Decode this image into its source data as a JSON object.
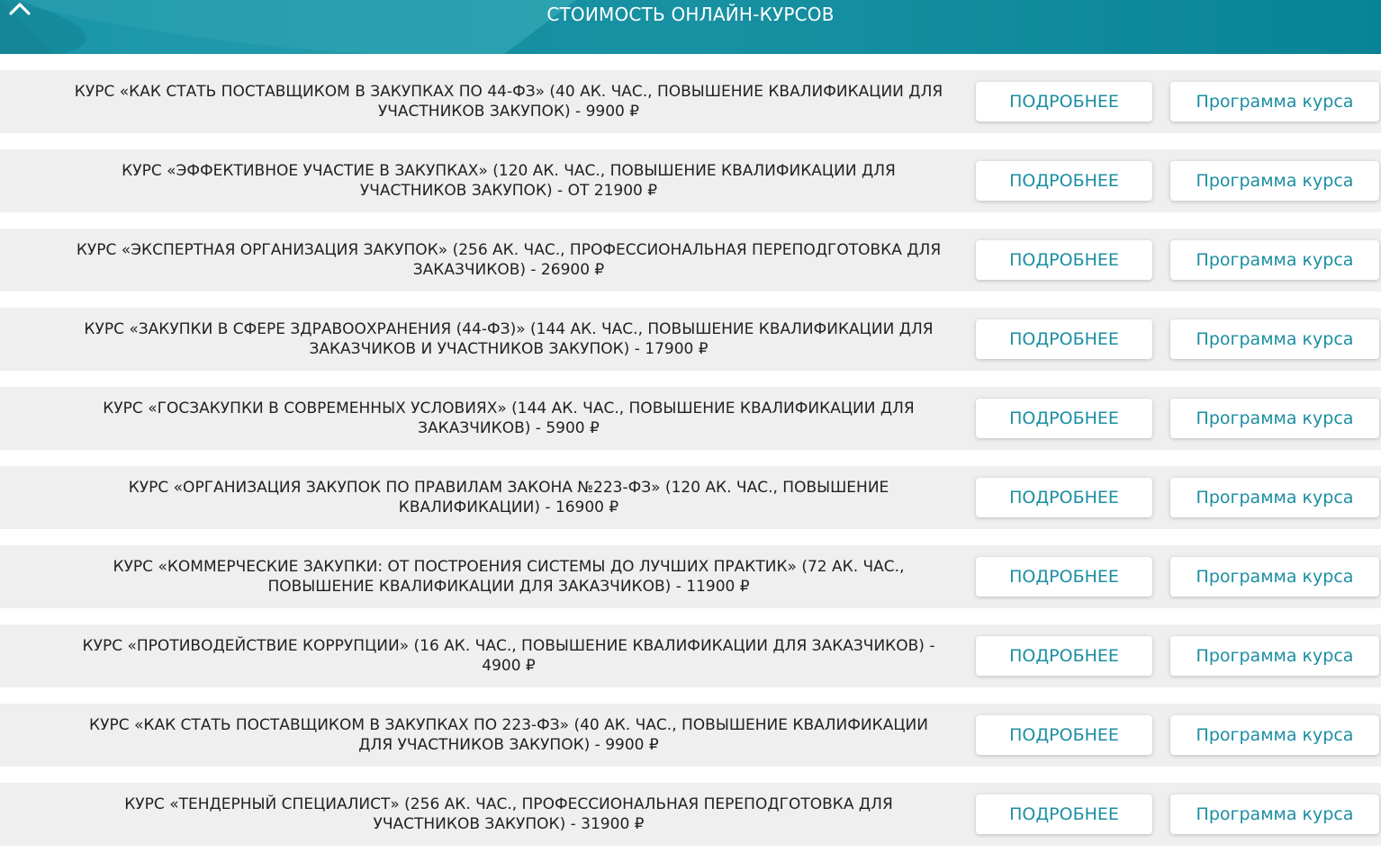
{
  "header": {
    "title": "СТОИМОСТЬ ОНЛАЙН-КУРСОВ",
    "toggle_icon": "chevron-up-icon",
    "bg_color": "#0d8a9e",
    "accent_color": "#1b8ea2"
  },
  "courses": [
    {
      "line1": "КУРС «КАК СТАТЬ ПОСТАВЩИКОМ В ЗАКУПКАХ ПО 44-ФЗ» (40 АК. ЧАС., ПОВЫШЕНИЕ КВАЛИФИКАЦИИ ДЛЯ",
      "line2": "УЧАСТНИКОВ ЗАКУПОК) - 9900 ₽",
      "more_label": "ПОДРОБНЕЕ",
      "program_label": "Программа курса"
    },
    {
      "line1": "КУРС «ЭФФЕКТИВНОЕ УЧАСТИЕ В ЗАКУПКАХ» (120 АК. ЧАС., ПОВЫШЕНИЕ КВАЛИФИКАЦИИ ДЛЯ",
      "line2": "УЧАСТНИКОВ ЗАКУПОК) - ОТ 21900 ₽",
      "more_label": "ПОДРОБНЕЕ",
      "program_label": "Программа курса"
    },
    {
      "line1": "КУРС «ЭКСПЕРТНАЯ ОРГАНИЗАЦИЯ ЗАКУПОК» (256 АК. ЧАС., ПРОФЕССИОНАЛЬНАЯ ПЕРЕПОДГОТОВКА ДЛЯ",
      "line2": "ЗАКАЗЧИКОВ) - 26900 ₽",
      "more_label": "ПОДРОБНЕЕ",
      "program_label": "Программа курса"
    },
    {
      "line1": "КУРС «ЗАКУПКИ В СФЕРЕ ЗДРАВООХРАНЕНИЯ (44-ФЗ)» (144 АК. ЧАС., ПОВЫШЕНИЕ КВАЛИФИКАЦИИ ДЛЯ",
      "line2": "ЗАКАЗЧИКОВ И УЧАСТНИКОВ ЗАКУПОК) - 17900 ₽",
      "more_label": "ПОДРОБНЕЕ",
      "program_label": "Программа курса"
    },
    {
      "line1": "КУРС «ГОСЗАКУПКИ В СОВРЕМЕННЫХ УСЛОВИЯХ» (144 АК. ЧАС., ПОВЫШЕНИЕ КВАЛИФИКАЦИИ ДЛЯ",
      "line2": "ЗАКАЗЧИКОВ) - 5900 ₽",
      "more_label": "ПОДРОБНЕЕ",
      "program_label": "Программа курса"
    },
    {
      "line1": "КУРС «ОРГАНИЗАЦИЯ ЗАКУПОК ПО ПРАВИЛАМ ЗАКОНА №223-ФЗ» (120 АК. ЧАС., ПОВЫШЕНИЕ",
      "line2": "КВАЛИФИКАЦИИ) - 16900 ₽",
      "more_label": "ПОДРОБНЕЕ",
      "program_label": "Программа курса"
    },
    {
      "line1": "КУРС «КОММЕРЧЕСКИЕ ЗАКУПКИ: ОТ ПОСТРОЕНИЯ СИСТЕМЫ ДО ЛУЧШИХ ПРАКТИК» (72 АК. ЧАС.,",
      "line2": "ПОВЫШЕНИЕ КВАЛИФИКАЦИИ ДЛЯ ЗАКАЗЧИКОВ) - 11900 ₽",
      "more_label": "ПОДРОБНЕЕ",
      "program_label": "Программа курса"
    },
    {
      "line1": "КУРС «ПРОТИВОДЕЙСТВИЕ КОРРУПЦИИ» (16 АК. ЧАС., ПОВЫШЕНИЕ КВАЛИФИКАЦИИ ДЛЯ ЗАКАЗЧИКОВ) -",
      "line2": "4900 ₽",
      "more_label": "ПОДРОБНЕЕ",
      "program_label": "Программа курса"
    },
    {
      "line1": "КУРС «КАК СТАТЬ ПОСТАВЩИКОМ В ЗАКУПКАХ ПО 223-ФЗ» (40 АК. ЧАС., ПОВЫШЕНИЕ КВАЛИФИКАЦИИ",
      "line2": "ДЛЯ УЧАСТНИКОВ ЗАКУПОК) - 9900 ₽",
      "more_label": "ПОДРОБНЕЕ",
      "program_label": "Программа курса"
    },
    {
      "line1": "КУРС «ТЕНДЕРНЫЙ СПЕЦИАЛИСТ» (256 АК. ЧАС., ПРОФЕССИОНАЛЬНАЯ ПЕРЕПОДГОТОВКА ДЛЯ",
      "line2": "УЧАСТНИКОВ ЗАКУПОК) - 31900 ₽",
      "more_label": "ПОДРОБНЕЕ",
      "program_label": "Программа курса"
    }
  ]
}
